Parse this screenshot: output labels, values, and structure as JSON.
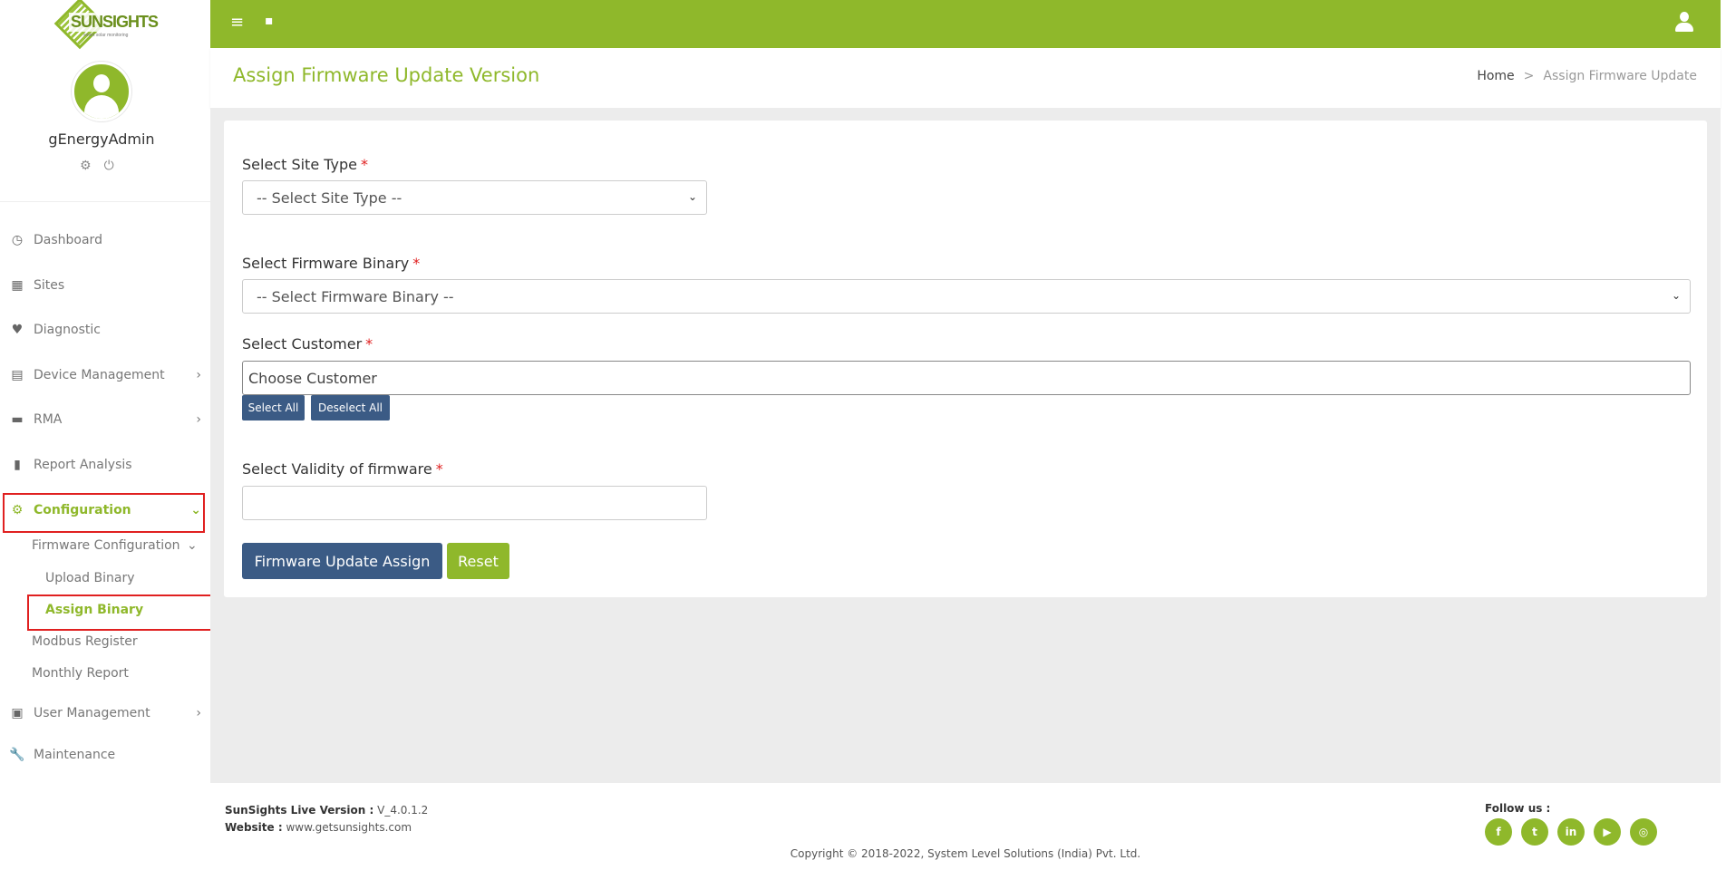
{
  "brand": {
    "name": "SUNSIGHTS",
    "tagline": "smart solar monitoring"
  },
  "user": {
    "name": "gEnergyAdmin",
    "settings_icon": "⚙",
    "power_icon": "⏻"
  },
  "colors": {
    "accent": "#8fb82b",
    "primary_button": "#3b5b85",
    "highlight": "#e02020"
  },
  "sidebar": {
    "items": [
      {
        "label": "Dashboard",
        "icon": "dashboard-icon",
        "glyph": "◷"
      },
      {
        "label": "Sites",
        "icon": "sites-icon",
        "glyph": "▦"
      },
      {
        "label": "Diagnostic",
        "icon": "heartbeat-icon",
        "glyph": "♥"
      },
      {
        "label": "Device Management",
        "icon": "device-icon",
        "glyph": "▤",
        "chevron": "›"
      },
      {
        "label": "RMA",
        "icon": "store-icon",
        "glyph": "▬",
        "chevron": "›"
      },
      {
        "label": "Report Analysis",
        "icon": "bar-chart-icon",
        "glyph": "▮"
      },
      {
        "label": "Configuration",
        "icon": "gear-icon",
        "glyph": "⚙",
        "chevron": "⌄"
      },
      {
        "label": "User Management",
        "icon": "id-card-icon",
        "glyph": "▣",
        "chevron": "›"
      },
      {
        "label": "Maintenance",
        "icon": "wrench-icon",
        "glyph": "🔧"
      }
    ],
    "submenu": {
      "firmware_configuration": "Firmware Configuration",
      "firmware_chevron": "⌄",
      "upload_binary": "Upload Binary",
      "assign_binary": "Assign Binary",
      "modbus_register": "Modbus Register",
      "monthly_report": "Monthly Report"
    }
  },
  "topbar": {
    "menu_glyph": "≡",
    "chat_glyph": "▪"
  },
  "page": {
    "title": "Assign Firmware Update Version",
    "breadcrumb": {
      "home": "Home",
      "sep": ">",
      "current": "Assign Firmware Update"
    }
  },
  "form": {
    "site_type": {
      "label": "Select Site Type",
      "value": "-- Select Site Type --"
    },
    "firmware_binary": {
      "label": "Select Firmware Binary",
      "value": "-- Select Firmware Binary --"
    },
    "customer": {
      "label": "Select Customer",
      "placeholder": "Choose Customer",
      "select_all": "Select All",
      "deselect_all": "Deselect All"
    },
    "validity": {
      "label": "Select Validity of firmware",
      "value": ""
    },
    "required_mark": "*",
    "caret": "⌄",
    "submit": "Firmware Update Assign",
    "reset": "Reset"
  },
  "footer": {
    "version_label": "SunSights Live Version :",
    "version_value": "V_4.0.1.2",
    "website_label": "Website :",
    "website_value": "www.getsunsights.com",
    "copyright": "Copyright © 2018-2022, System Level Solutions (India) Pvt. Ltd.",
    "follow_us": "Follow us :",
    "socials": [
      {
        "name": "facebook-icon",
        "glyph": "f"
      },
      {
        "name": "twitter-icon",
        "glyph": "t"
      },
      {
        "name": "linkedin-icon",
        "glyph": "in"
      },
      {
        "name": "youtube-icon",
        "glyph": "▶"
      },
      {
        "name": "instagram-icon",
        "glyph": "◎"
      }
    ]
  }
}
